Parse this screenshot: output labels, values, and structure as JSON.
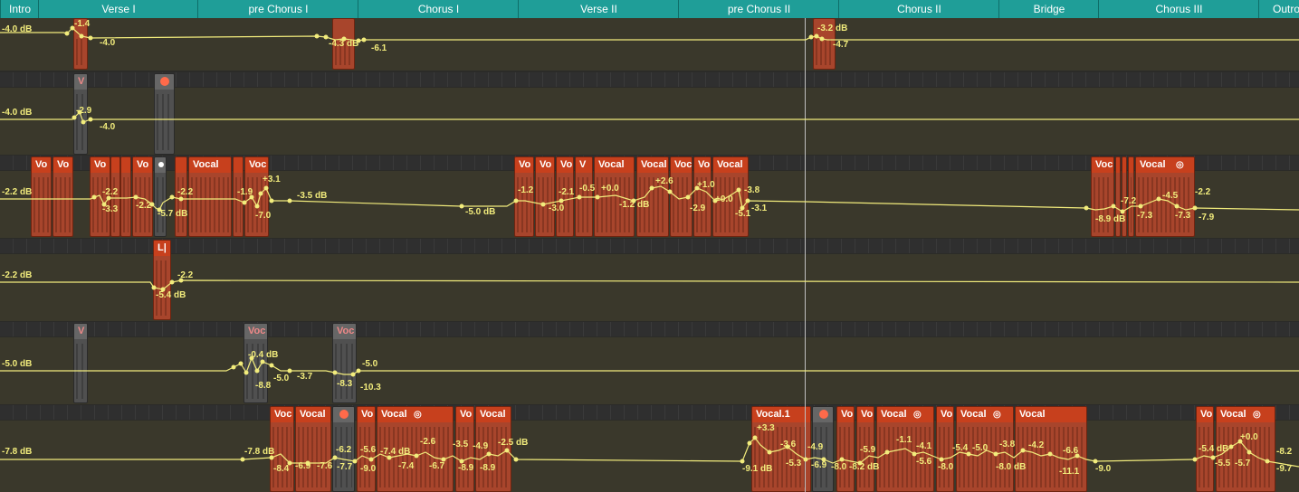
{
  "markers": [
    "Intro",
    "Verse I",
    "pre Chorus I",
    "Chorus I",
    "Verse II",
    "pre Chorus II",
    "Chorus II",
    "Bridge",
    "Chorus III",
    "Outro"
  ],
  "regions": {
    "vo": "Vo",
    "v": "V",
    "vocal": "Vocal",
    "voc": "Voc",
    "vocal1": "Vocal.1",
    "lr": "L|"
  },
  "labels": {
    "t1": [
      "-4.0 dB",
      "-1.4",
      "-4.0",
      "-4.3 dB",
      "-6.1",
      "-3.2 dB",
      "-4.7"
    ],
    "t2": [
      "-4.0 dB",
      "-2.9",
      "-4.0"
    ],
    "t3": [
      "-2.2 dB",
      "-2.2",
      "-3.3",
      "-2.2",
      "-5.7 dB",
      "-2.2",
      "-1.9",
      "+3.1",
      "-7.0",
      "-3.5 dB",
      "-5.0 dB",
      "-1.2",
      "-3.0",
      "-2.1",
      "-0.5",
      "+0.0",
      "-1.2 dB",
      "+2.6",
      "-2.9",
      "+1.0",
      "+0.0",
      "-3.8",
      "-5.1",
      "-3.1",
      "-8.9 dB",
      "-7.2",
      "-7.3",
      "-4.5",
      "-2.2",
      "-7.3",
      "-7.9"
    ],
    "t4": [
      "-2.2 dB",
      "-5.4 dB",
      "-2.2"
    ],
    "t5": [
      "-5.0 dB",
      "-0.4 dB",
      "-8.8",
      "-5.0",
      "-3.7",
      "-8.3",
      "-5.0",
      "-10.3"
    ],
    "t6": [
      "-7.8 dB",
      "-7.8 dB",
      "-8.4",
      "-6.9",
      "-7.6",
      "-6.2",
      "-7.7",
      "-5.6",
      "-9.0",
      "-7.4 dB",
      "-7.4",
      "-2.6",
      "-6.7",
      "-3.5",
      "-8.9",
      "-4.9",
      "-8.9",
      "-2.5 dB",
      "-9.1 dB",
      "+3.3",
      "-3.6",
      "-5.3",
      "-4.9",
      "-6.9",
      "-8.0",
      "-8.2 dB",
      "-5.9",
      "-1.1",
      "-4.1",
      "-5.6",
      "-8.0",
      "-5.4",
      "-5.0",
      "-3.8",
      "-8.0 dB",
      "-4.2",
      "-6.6",
      "-11.1",
      "-9.0",
      "-5.4 dB",
      "+0.0",
      "-5.5",
      "-5.7",
      "-9.7",
      "-8.2"
    ]
  },
  "colors": {
    "automation": "#f2ec7c",
    "region": "#a8452c",
    "header": "#c7401d",
    "ruler": "#1f9e98"
  }
}
